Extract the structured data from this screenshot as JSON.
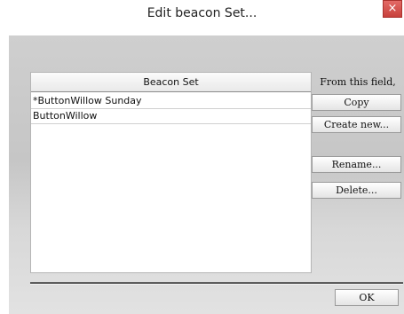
{
  "window": {
    "title": "Edit beacon Set...",
    "close_label": "×"
  },
  "list": {
    "header": "Beacon Set",
    "rows": [
      "*ButtonWillow Sunday",
      "ButtonWillow"
    ]
  },
  "side": {
    "label": "From this field,",
    "copy_label": "Copy",
    "create_label": "Create new...",
    "rename_label": "Rename...",
    "delete_label": "Delete..."
  },
  "footer": {
    "ok_label": "OK"
  },
  "colors": {
    "close_button": "#d9534f",
    "client_background": "#c8c8c8",
    "divider": "#5c5c5c"
  }
}
